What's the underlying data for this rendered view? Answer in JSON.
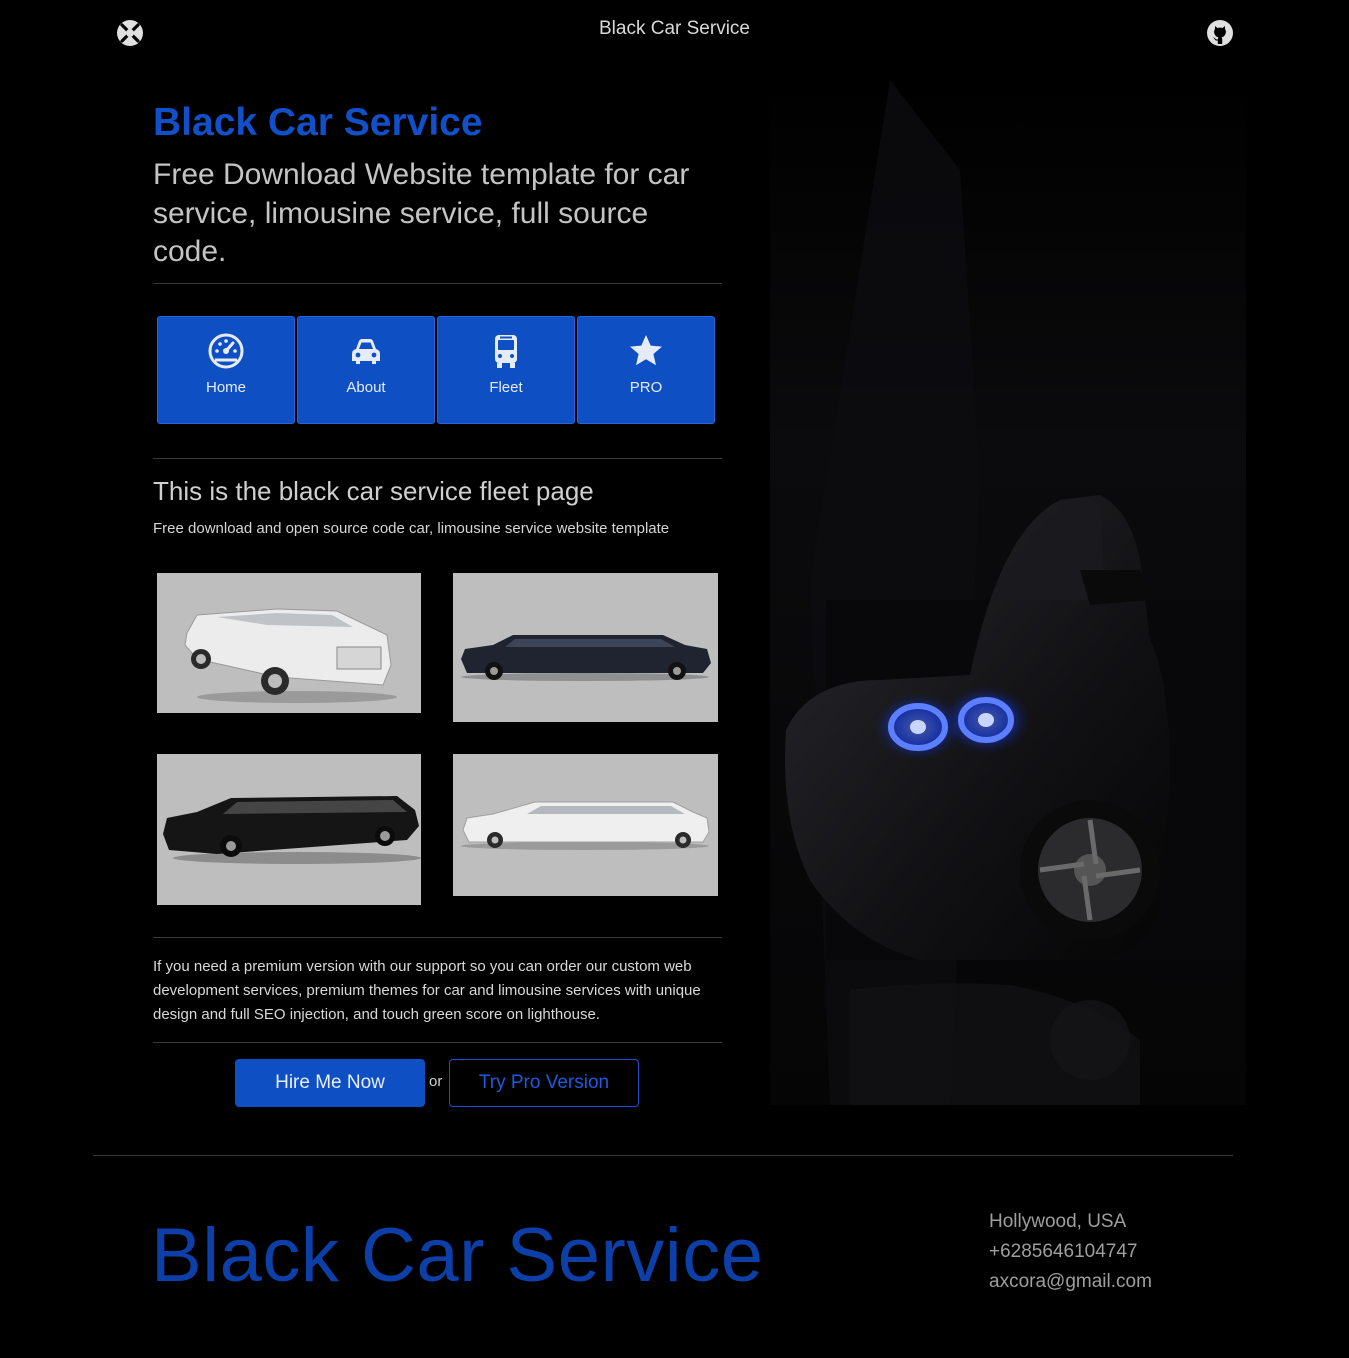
{
  "header": {
    "site_title": "Black Car Service",
    "logo_icon": "xbox-logo-icon",
    "repo_icon": "github-icon"
  },
  "intro": {
    "brand_title": "Black Car Service",
    "tagline": "Free Download Website template for car service, limousine service, full source code."
  },
  "nav": {
    "items": [
      {
        "label": "Home",
        "icon": "speedometer-icon"
      },
      {
        "label": "About",
        "icon": "car-icon"
      },
      {
        "label": "Fleet",
        "icon": "bus-icon"
      },
      {
        "label": "PRO",
        "icon": "star-icon"
      }
    ]
  },
  "fleet": {
    "heading": "This is the black car service fleet page",
    "subheading": "Free download and open source code car, limousine service website template",
    "cards": [
      {
        "name": "white-stretch-limousine-photo",
        "color": "#e8e8e8"
      },
      {
        "name": "black-stretch-limousine-side-photo",
        "color": "#1f2430"
      },
      {
        "name": "black-lincoln-limousine-photo",
        "color": "#151515"
      },
      {
        "name": "white-lincoln-limousine-photo",
        "color": "#efefef"
      }
    ]
  },
  "premium": {
    "text": "If you need a premium version with our support so you can order our custom web development services, premium themes for car and limousine services with unique design and full SEO injection, and touch green score on lighthouse.",
    "hire_label": "Hire Me Now",
    "or_label": "or",
    "pro_label": "Try Pro Version"
  },
  "footer": {
    "brand": "Black Car Service",
    "location": "Hollywood, USA",
    "phone": "+6285646104747",
    "email": "axcora@gmail.com"
  },
  "colors": {
    "accent": "#0f4fc4",
    "footer_brand": "#0d3fa8",
    "headlight": "#2a5bff",
    "background": "#000000"
  }
}
